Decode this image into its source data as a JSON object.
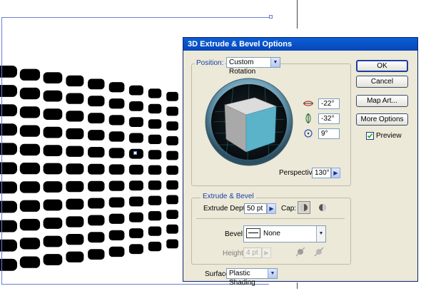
{
  "dialog": {
    "title": "3D Extrude & Bevel Options",
    "position_label": "Position:",
    "position_value": "Custom Rotation",
    "rotation": {
      "x": "-22°",
      "y": "-32°",
      "z": "9°"
    },
    "perspective_label": "Perspective:",
    "perspective_value": "130°",
    "extrude_group_label": "Extrude & Bevel",
    "extrude_depth_label": "Extrude Depth:",
    "extrude_depth_value": "50 pt",
    "cap_label": "Cap:",
    "bevel_label": "Bevel:",
    "bevel_value": "None",
    "height_label": "Height:",
    "height_value": "4 pt",
    "surface_label": "Surface:",
    "surface_value": "Plastic Shading",
    "buttons": {
      "ok": "OK",
      "cancel": "Cancel",
      "map_art": "Map Art...",
      "more_options": "More Options"
    },
    "preview_label": "Preview",
    "preview_checked": true
  },
  "colors": {
    "accent": "#1c3da5",
    "cube_front": "#5ab3c9",
    "cube_side": "#a8a8a8",
    "artwork": "#000000"
  }
}
